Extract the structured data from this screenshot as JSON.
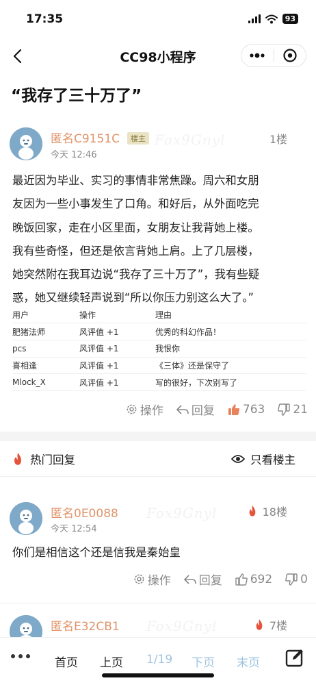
{
  "status_bar": {
    "time": "17:35",
    "battery": "93"
  },
  "nav": {
    "title": "CC98小程序"
  },
  "topic": {
    "title": "“我存了三十万了”"
  },
  "main_post": {
    "author": "匿名C9151C",
    "badge": "楼主",
    "time": "今天 12:46",
    "floor": "1楼",
    "watermark": "Fox9Gnyl",
    "lines": [
      "最近因为毕业、实习的事情非常焦躁。周六和女朋",
      "友因为一些小事发生了口角。和好后，从外面吃完",
      "晚饭回家，走在小区里面，女朋友让我背她上楼。",
      "我有些奇怪，但还是依言背她上肩。上了几层楼，",
      "她突然附在我耳边说“我存了三十万了”，我有些疑",
      "惑，她又继续轻声说到“所以你压力别这么大了。”"
    ],
    "rating_headers": [
      "用户",
      "操作",
      "理由"
    ],
    "ratings": [
      [
        "肥猪法师",
        "风评值 +1",
        "优秀的科幻作品！"
      ],
      [
        "pcs",
        "风评值 +1",
        "我恨你"
      ],
      [
        "喜相逢",
        "风评值 +1",
        "《三体》还是保守了"
      ],
      [
        "Mlock_X",
        "风评值 +1",
        "写的很好，下次别写了"
      ]
    ],
    "actions": {
      "operate": "操作",
      "reply": "回复",
      "likes": "763",
      "dislikes": "21"
    }
  },
  "hot": {
    "title": "热门回复",
    "only_host": "只看楼主"
  },
  "replies": [
    {
      "author": "匿名0E0088",
      "time": "今天 12:54",
      "floor": "18楼",
      "watermark": "Fox9Gnyl",
      "content": "你们是相信这个还是信我是秦始皇",
      "actions": {
        "operate": "操作",
        "reply": "回复",
        "likes": "692",
        "dislikes": "0"
      }
    },
    {
      "author": "匿名E32CB1",
      "floor": "7楼",
      "watermark": "Fox9Gnyl"
    }
  ],
  "bottom_bar": {
    "first": "首页",
    "prev": "上页",
    "page": "1/19",
    "next": "下页",
    "last": "末页"
  },
  "colors": {
    "author": "#e0946a",
    "like_active": "#e8825c",
    "pager_inactive": "#9ec3e0",
    "hot_flame": "#e5533b"
  }
}
